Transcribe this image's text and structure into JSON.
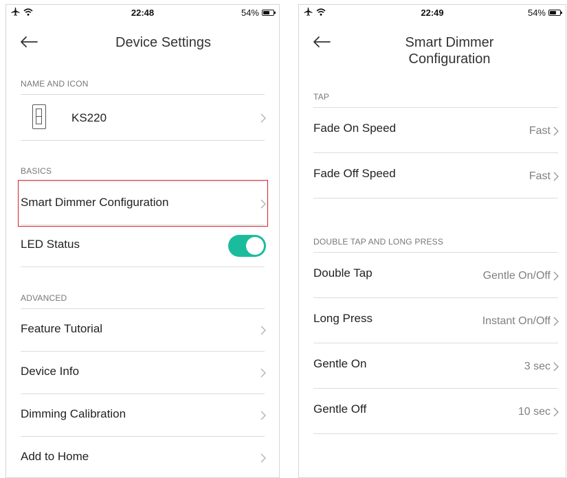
{
  "left": {
    "status": {
      "time": "22:48",
      "battery": "54%",
      "battery_level": 0.54
    },
    "title": "Device Settings",
    "sections": {
      "name_icon": "NAME AND ICON",
      "basics": "BASICS",
      "advanced": "ADVANCED"
    },
    "device_name": "KS220",
    "basics": {
      "dimmer_config": "Smart Dimmer Configuration",
      "led_status": "LED Status",
      "led_status_on": true
    },
    "advanced": {
      "feature_tutorial": "Feature Tutorial",
      "device_info": "Device Info",
      "dimming_calibration": "Dimming Calibration",
      "add_to_home": "Add to Home"
    }
  },
  "right": {
    "status": {
      "time": "22:49",
      "battery": "54%",
      "battery_level": 0.54
    },
    "title_line1": "Smart Dimmer",
    "title_line2": "Configuration",
    "sections": {
      "tap": "TAP",
      "double_long": "DOUBLE TAP AND LONG PRESS"
    },
    "tap": {
      "fade_on_label": "Fade On Speed",
      "fade_on_value": "Fast",
      "fade_off_label": "Fade Off Speed",
      "fade_off_value": "Fast"
    },
    "double_long": {
      "double_tap_label": "Double Tap",
      "double_tap_value": "Gentle On/Off",
      "long_press_label": "Long Press",
      "long_press_value": "Instant On/Off",
      "gentle_on_label": "Gentle On",
      "gentle_on_value": "3 sec",
      "gentle_off_label": "Gentle Off",
      "gentle_off_value": "10 sec"
    }
  },
  "colors": {
    "accent": "#1abc9c",
    "highlight": "#d0202a"
  }
}
